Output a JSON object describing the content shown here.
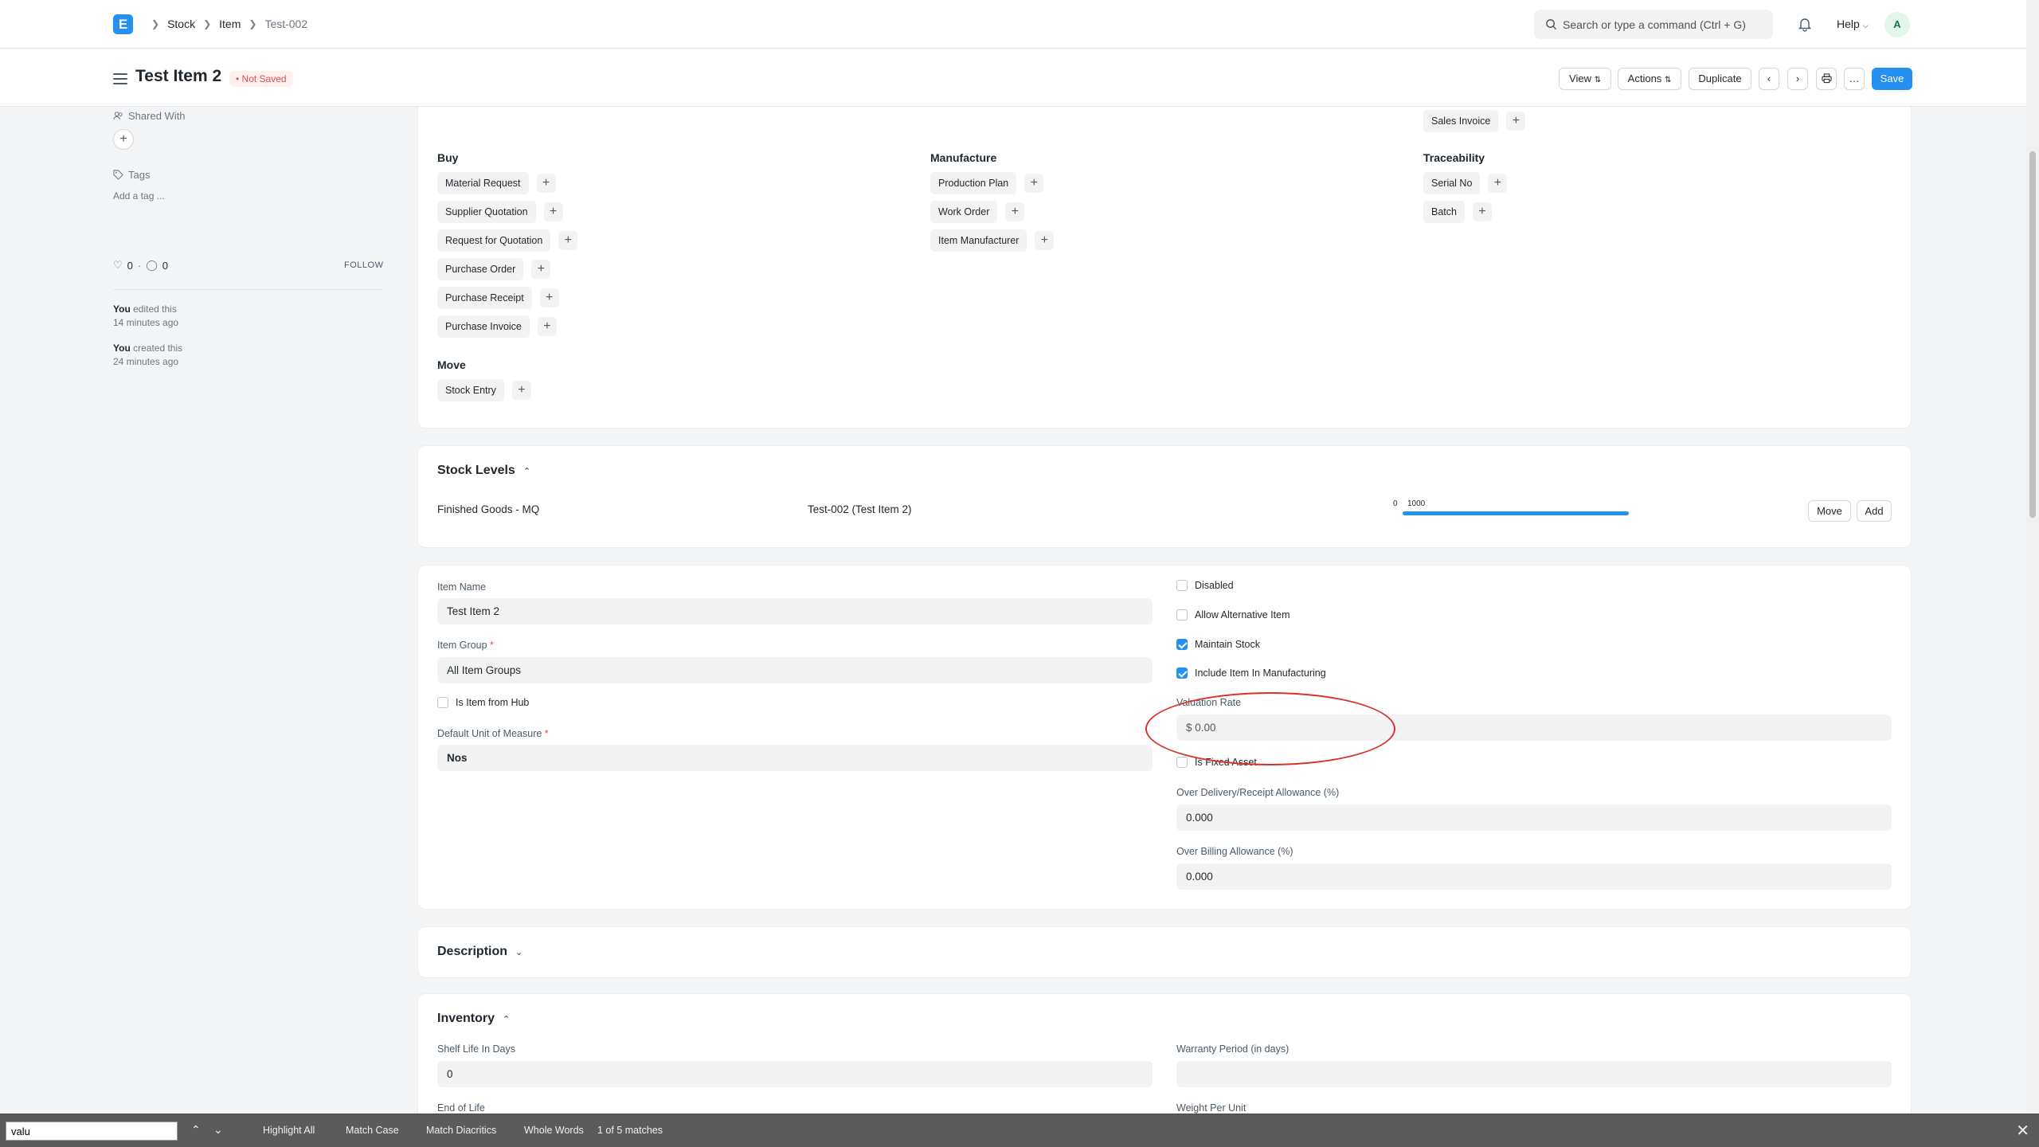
{
  "navbar": {
    "brand_letter": "E",
    "breadcrumbs": [
      "Stock",
      "Item",
      "Test-002"
    ],
    "search_placeholder": "Search or type a command (Ctrl + G)",
    "help_label": "Help",
    "avatar_letter": "A"
  },
  "page": {
    "title": "Test Item 2",
    "status": "Not Saved",
    "buttons": {
      "view": "View",
      "actions": "Actions",
      "duplicate": "Duplicate",
      "save": "Save"
    }
  },
  "sidebar": {
    "shared_with": "Shared With",
    "tags": "Tags",
    "add_tag": "Add a tag ...",
    "likes": "0",
    "comments": "0",
    "follow": "FOLLOW",
    "activity": [
      {
        "who": "You",
        "what": " edited this",
        "when": "14 minutes ago"
      },
      {
        "who": "You",
        "what": " created this",
        "when": "24 minutes ago"
      }
    ]
  },
  "connections": {
    "sales_invoice": "Sales Invoice",
    "buy": {
      "title": "Buy",
      "items": [
        "Material Request",
        "Supplier Quotation",
        "Request for Quotation",
        "Purchase Order",
        "Purchase Receipt",
        "Purchase Invoice"
      ]
    },
    "manufacture": {
      "title": "Manufacture",
      "items": [
        "Production Plan",
        "Work Order",
        "Item Manufacturer"
      ]
    },
    "traceability": {
      "title": "Traceability",
      "items": [
        "Serial No",
        "Batch"
      ]
    },
    "move": {
      "title": "Move",
      "items": [
        "Stock Entry"
      ]
    }
  },
  "stock_levels": {
    "title": "Stock Levels",
    "warehouse": "Finished Goods - MQ",
    "item": "Test-002 (Test Item 2)",
    "bar_min_label": "0",
    "bar_max_label": "1000",
    "fill_fraction": 1.0,
    "move_label": "Move",
    "add_label": "Add"
  },
  "details": {
    "item_name_label": "Item Name",
    "item_name": "Test Item 2",
    "item_group_label": "Item Group",
    "item_group": "All Item Groups",
    "is_item_from_hub": "Is Item from Hub",
    "uom_label": "Default Unit of Measure",
    "uom": "Nos",
    "disabled": "Disabled",
    "allow_alternative": "Allow Alternative Item",
    "maintain_stock": "Maintain Stock",
    "include_manufacturing": "Include Item In Manufacturing",
    "valuation_rate_label": "Valuation Rate",
    "valuation_rate": "$ 0.00",
    "is_fixed_asset": "Is Fixed Asset",
    "over_delivery_label": "Over Delivery/Receipt Allowance (%)",
    "over_delivery": "0.000",
    "over_billing_label": "Over Billing Allowance (%)",
    "over_billing": "0.000"
  },
  "description": {
    "title": "Description"
  },
  "inventory": {
    "title": "Inventory",
    "shelf_life_label": "Shelf Life In Days",
    "shelf_life": "0",
    "warranty_label": "Warranty Period (in days)",
    "warranty": "",
    "end_of_life_label": "End of Life",
    "weight_label": "Weight Per Unit"
  },
  "findbar": {
    "query": "valu",
    "highlight_all": "Highlight All",
    "match_case": "Match Case",
    "match_diacritics": "Match Diacritics",
    "whole_words": "Whole Words",
    "status": "1 of 5 matches"
  }
}
